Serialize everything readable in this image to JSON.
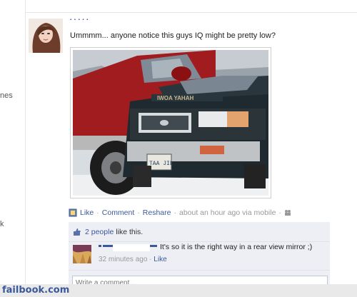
{
  "post": {
    "text": "Ummmm... anyone notice this guys IQ might be pretty low?",
    "plate_text": "TAA JIL",
    "windshield_text": "IWOA YAHAH"
  },
  "sidebar": {
    "crop_1": "nes",
    "crop_2": "k"
  },
  "actions": {
    "like": "Like",
    "comment": "Comment",
    "reshare": "Reshare",
    "time": "about an hour ago via mobile"
  },
  "likes": {
    "people": "2 people",
    "suffix": "like this."
  },
  "comment": {
    "text": "It's so it is the right way in a rear view mirror ;)",
    "time": "32 minutes ago",
    "like": "Like"
  },
  "composer": {
    "placeholder": "Write a comment..."
  },
  "watermark": {
    "text": "failbook.com"
  },
  "icons": [
    "audience-icon",
    "mobile-icon",
    "thumbs-up-icon"
  ],
  "colors": {
    "link": "#3b5998",
    "ufi_bg": "#edeff4",
    "meta": "#999999"
  }
}
